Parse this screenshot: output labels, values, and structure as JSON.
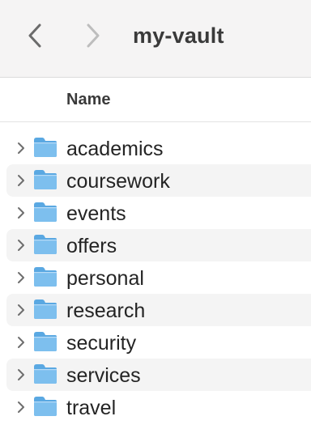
{
  "window": {
    "title": "my-vault"
  },
  "toolbar": {
    "back_icon": "chevron-left-icon",
    "forward_icon": "chevron-right-icon"
  },
  "columns": {
    "name": "Name"
  },
  "colors": {
    "folder": "#7dbfee",
    "folder_tab": "#5aa8e2",
    "stripe": "#f4f4f4",
    "toolbar": "#f5f4f4"
  },
  "items": [
    {
      "label": "academics",
      "icon": "folder-icon"
    },
    {
      "label": "coursework",
      "icon": "folder-icon"
    },
    {
      "label": "events",
      "icon": "folder-icon"
    },
    {
      "label": "offers",
      "icon": "folder-icon"
    },
    {
      "label": "personal",
      "icon": "folder-icon"
    },
    {
      "label": "research",
      "icon": "folder-icon"
    },
    {
      "label": "security",
      "icon": "folder-icon"
    },
    {
      "label": "services",
      "icon": "folder-icon"
    },
    {
      "label": "travel",
      "icon": "folder-icon"
    }
  ]
}
